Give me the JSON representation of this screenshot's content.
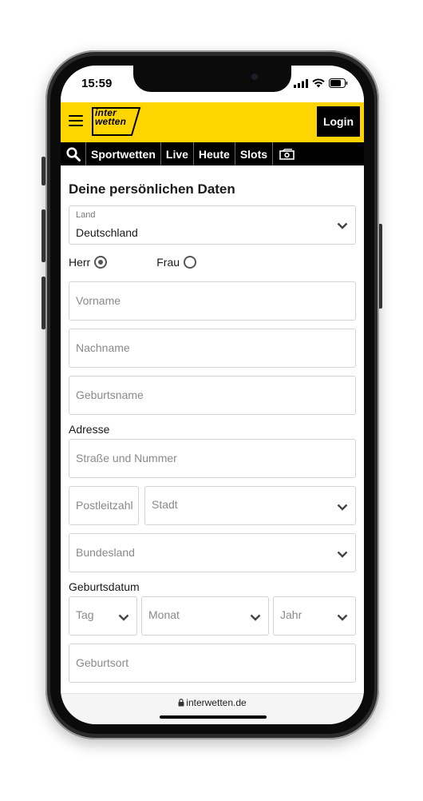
{
  "status_bar": {
    "time": "15:59"
  },
  "header": {
    "logo_line1": "inter",
    "logo_line2": "wetten",
    "login_label": "Login",
    "accent_color": "#ffd500"
  },
  "nav": {
    "search_icon": "search-icon",
    "items": [
      "Sportwetten",
      "Live",
      "Heute",
      "Slots"
    ],
    "cash_icon": "cash-icon"
  },
  "form": {
    "title": "Deine persönlichen Daten",
    "country": {
      "label": "Land",
      "value": "Deutschland"
    },
    "salutation": {
      "options": [
        "Herr",
        "Frau"
      ],
      "selected": "Herr"
    },
    "first_name_placeholder": "Vorname",
    "last_name_placeholder": "Nachname",
    "birth_name_placeholder": "Geburtsname",
    "address_label": "Adresse",
    "street_placeholder": "Straße und Nummer",
    "postal_placeholder": "Postleitzahl",
    "city_placeholder": "Stadt",
    "state_placeholder": "Bundesland",
    "birthdate_label": "Geburtsdatum",
    "day_placeholder": "Tag",
    "month_placeholder": "Monat",
    "year_placeholder": "Jahr",
    "birthplace_placeholder": "Geburtsort"
  },
  "browser": {
    "url": "interwetten.de"
  }
}
